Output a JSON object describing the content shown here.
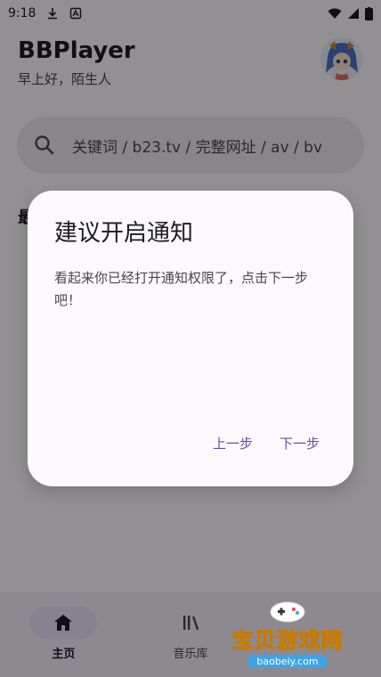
{
  "status_bar": {
    "time": "9:18"
  },
  "header": {
    "app_title": "BBPlayer",
    "greeting": "早上好，陌生人"
  },
  "search": {
    "placeholder": "关键词 / b23.tv / 完整网址 / av / bv"
  },
  "section": {
    "peek_text": "最"
  },
  "navigation": {
    "items": [
      {
        "label": "主页",
        "icon": "home-icon",
        "active": true
      },
      {
        "label": "音乐库",
        "icon": "library-icon",
        "active": false
      }
    ]
  },
  "dialog": {
    "title": "建议开启通知",
    "body": "看起来你已经打开通知权限了，点击下一步吧！",
    "prev_label": "上一步",
    "next_label": "下一步"
  },
  "watermark": {
    "text": "宝贝游戏网",
    "url": "baobeiy.com"
  },
  "colors": {
    "accent": "#6750a4",
    "nav_active_pill": "#e8def8",
    "search_bg": "#ece6f0"
  }
}
